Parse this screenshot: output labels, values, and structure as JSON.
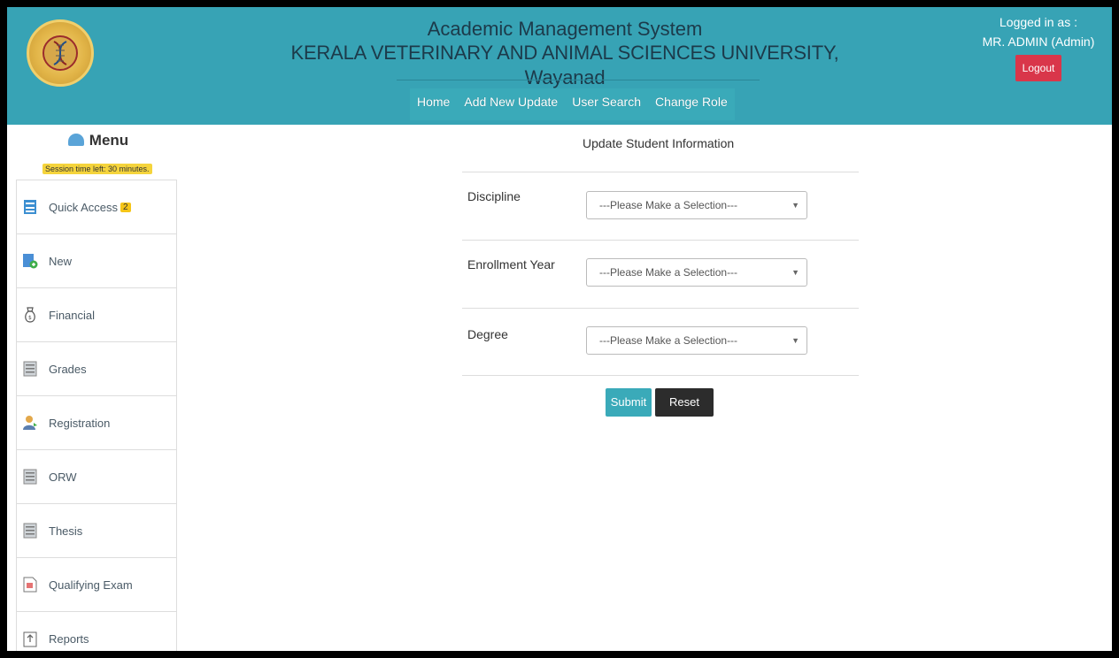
{
  "header": {
    "title_line1": "Academic Management System",
    "title_line2": "KERALA VETERINARY AND ANIMAL SCIENCES UNIVERSITY, Wayanad",
    "nav": [
      "Home",
      "Add New Update",
      "User Search",
      "Change Role"
    ],
    "logged_in_label": "Logged in as :",
    "user": "MR. ADMIN (Admin)",
    "logout_label": "Logout",
    "colors": {
      "header_bg": "#37a3b5",
      "logout_bg": "#d9364a"
    }
  },
  "sidebar": {
    "menu_title": "Menu",
    "session_text": "Session time left: 30 minutes.",
    "items": [
      {
        "label": "Quick Access",
        "badge": "2",
        "icon": "quick-access-icon"
      },
      {
        "label": "New",
        "icon": "new-document-icon"
      },
      {
        "label": "Financial",
        "icon": "money-bag-icon"
      },
      {
        "label": "Grades",
        "icon": "grades-document-icon"
      },
      {
        "label": "Registration",
        "icon": "user-icon"
      },
      {
        "label": "ORW",
        "icon": "document-icon"
      },
      {
        "label": "Thesis",
        "icon": "document-icon"
      },
      {
        "label": "Qualifying Exam",
        "icon": "pdf-file-icon"
      },
      {
        "label": "Reports",
        "icon": "report-icon"
      }
    ]
  },
  "form": {
    "title": "Update Student Information",
    "fields": [
      {
        "label": "Discipline",
        "value": "---Please Make a Selection---"
      },
      {
        "label": "Enrollment Year",
        "value": "---Please Make a Selection---"
      },
      {
        "label": "Degree",
        "value": "---Please Make a Selection---"
      }
    ],
    "submit_label": "Submit",
    "reset_label": "Reset"
  }
}
